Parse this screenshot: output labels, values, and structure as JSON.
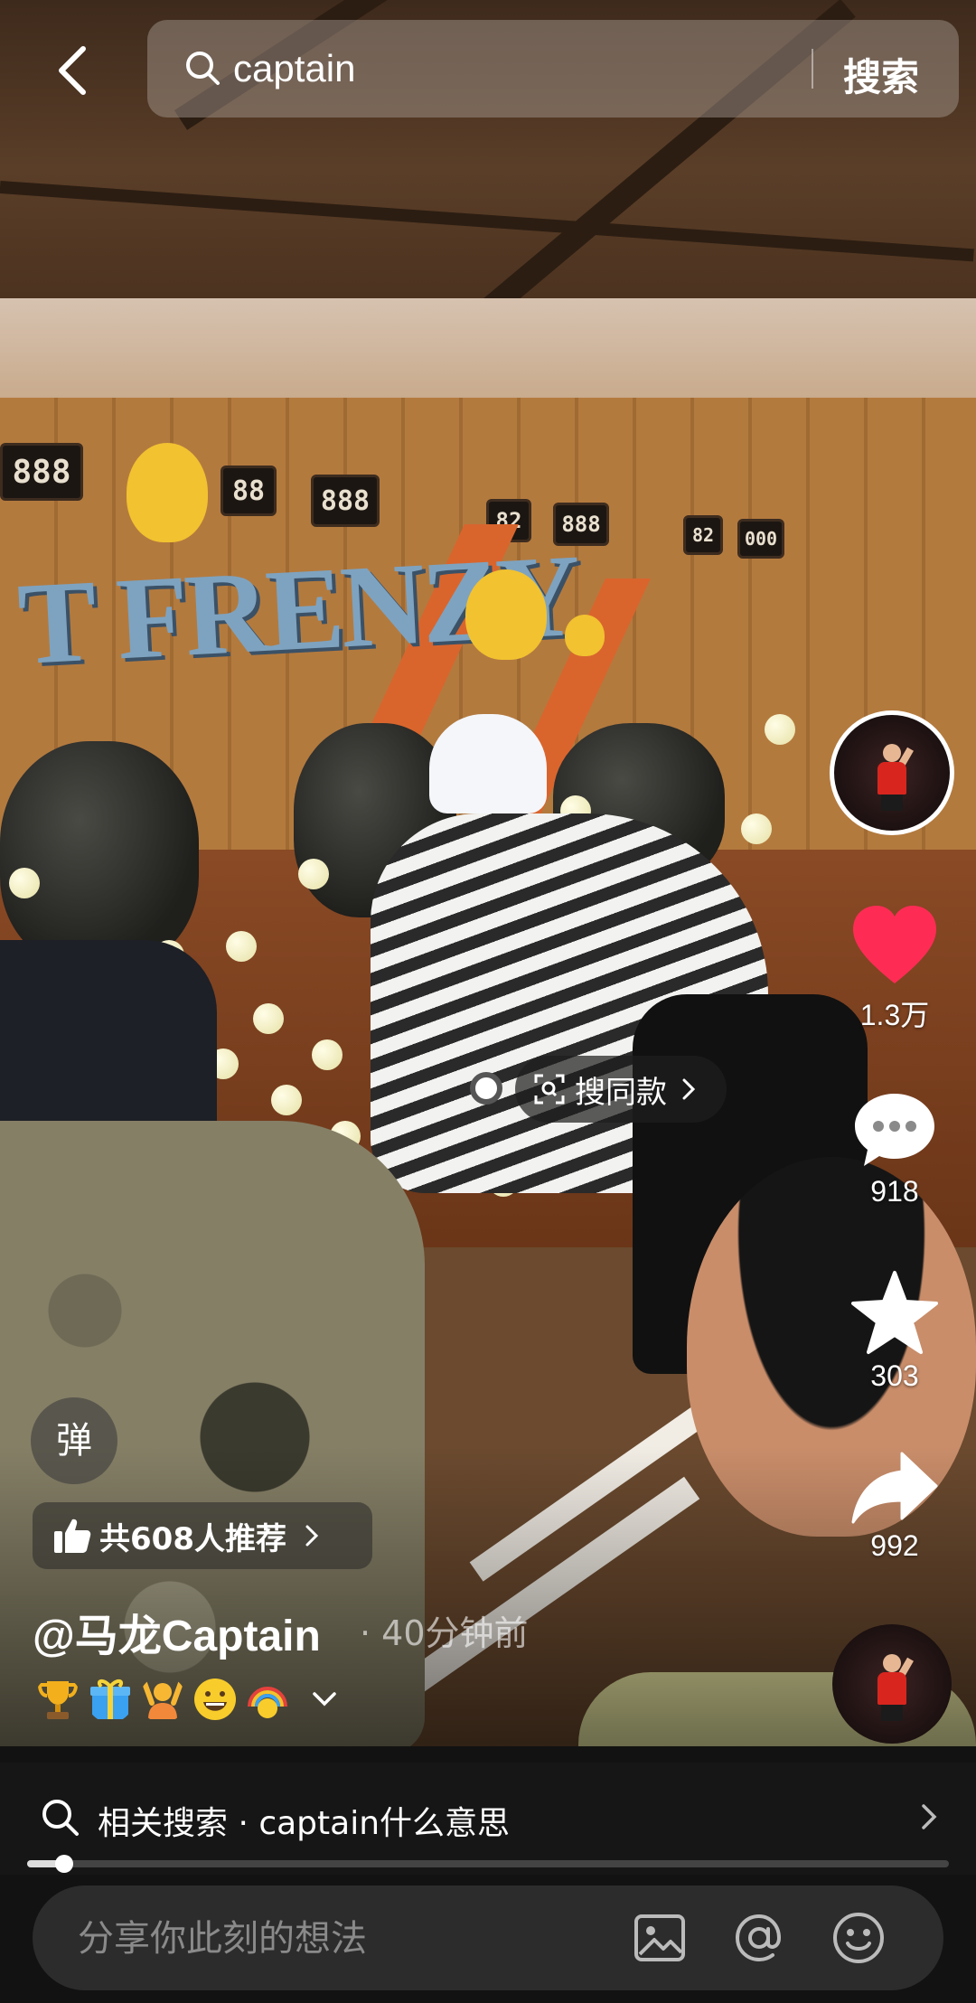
{
  "search": {
    "query": "captain",
    "button_label": "搜索"
  },
  "actions": {
    "like_count": "1.3万",
    "comment_count": "918",
    "favorite_count": "303",
    "share_count": "992",
    "like_color": "#fe2c55"
  },
  "search_same": {
    "label": "搜同款"
  },
  "danmu": {
    "label": "弹"
  },
  "recommend": {
    "label": "共608人推荐"
  },
  "author": {
    "name": "@马龙Captain",
    "time": "· 40分钟前"
  },
  "emojis": [
    "trophy",
    "gift",
    "person-raising-hands",
    "grinning-face",
    "rainbow-face"
  ],
  "related_search": {
    "label": "相关搜索 · captain什么意思"
  },
  "progress": {
    "fraction": 0.04
  },
  "comment": {
    "placeholder": "分享你此刻的想法"
  }
}
